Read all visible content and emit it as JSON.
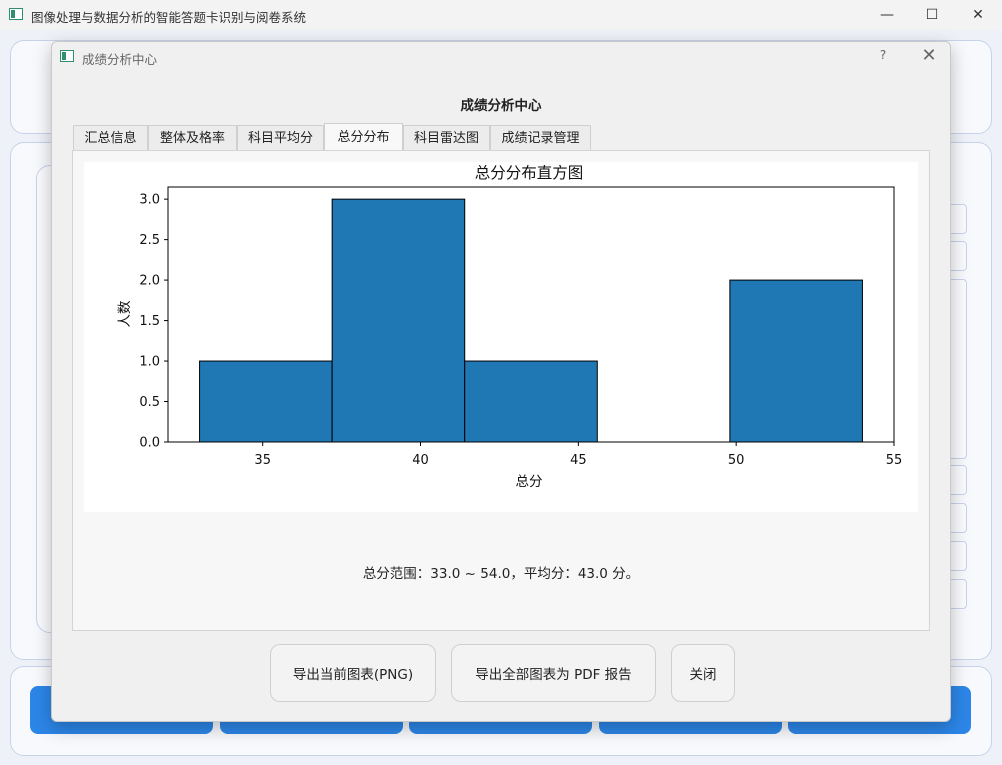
{
  "window": {
    "title": "图像处理与数据分析的智能答题卡识别与阅卷系统",
    "controls": {
      "minimize": "—",
      "maximize": "☐",
      "close": "✕"
    }
  },
  "dialog": {
    "title": "成绩分析中心",
    "help": "?",
    "close": "✕",
    "heading": "成绩分析中心",
    "tabs": [
      {
        "label": "汇总信息",
        "active": false
      },
      {
        "label": "整体及格率",
        "active": false
      },
      {
        "label": "科目平均分",
        "active": false
      },
      {
        "label": "总分分布",
        "active": true
      },
      {
        "label": "科目雷达图",
        "active": false
      },
      {
        "label": "成绩记录管理",
        "active": false
      }
    ],
    "summary": "总分范围：33.0 ~ 54.0，平均分：43.0 分。",
    "buttons": {
      "export_png": "导出当前图表(PNG)",
      "export_pdf": "导出全部图表为 PDF 报告",
      "close": "关闭"
    }
  },
  "chart_data": {
    "type": "bar",
    "title": "总分分布直方图",
    "xlabel": "总分",
    "ylabel": "人数",
    "bins": [
      {
        "start": 33.0,
        "end": 37.2,
        "count": 1
      },
      {
        "start": 37.2,
        "end": 41.4,
        "count": 3
      },
      {
        "start": 41.4,
        "end": 45.6,
        "count": 1
      },
      {
        "start": 45.6,
        "end": 49.8,
        "count": 0
      },
      {
        "start": 49.8,
        "end": 54.0,
        "count": 2
      }
    ],
    "xlim": [
      32,
      55
    ],
    "ylim": [
      0,
      3.15
    ],
    "xticks": [
      35,
      40,
      45,
      50,
      55
    ],
    "yticks": [
      "0.0",
      "0.5",
      "1.0",
      "1.5",
      "2.0",
      "2.5",
      "3.0"
    ],
    "bar_color": "#1f77b4",
    "grid": false,
    "legend": false
  }
}
